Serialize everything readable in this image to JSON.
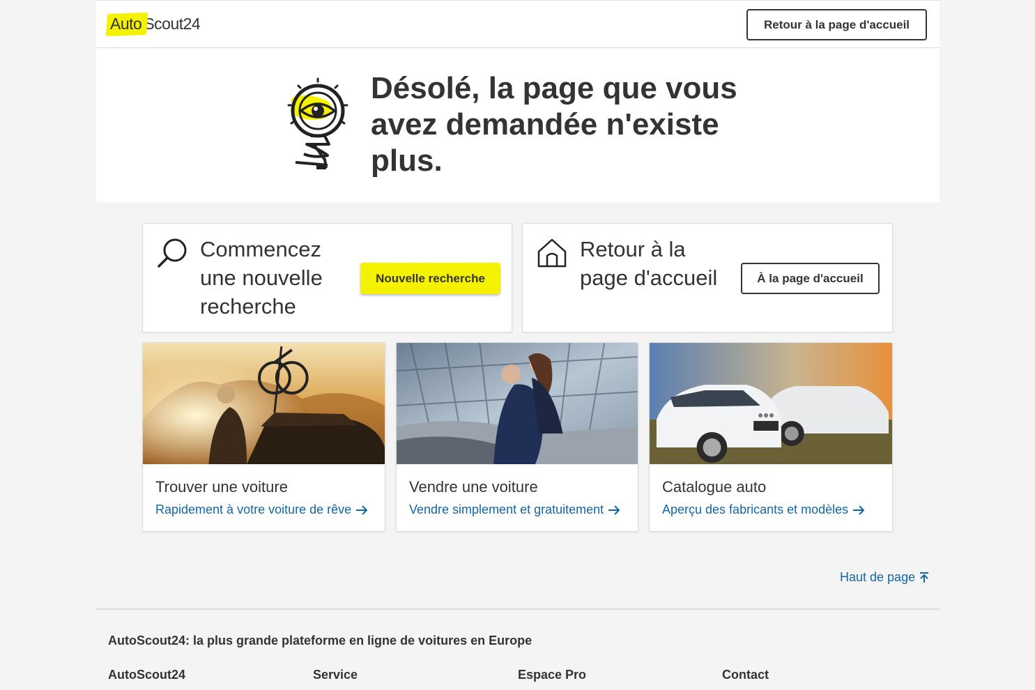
{
  "header": {
    "logo_part1": "Auto",
    "logo_part2": "Scout24",
    "home_button": "Retour à la page d'accueil"
  },
  "hero": {
    "title": "Désolé, la page que vous avez demandée n'existe plus.",
    "icon": "lightbulb-eye-icon"
  },
  "cards": {
    "search": {
      "text": "Commencez une nouvelle recherche",
      "button": "Nouvelle recherche",
      "icon": "search-icon"
    },
    "home": {
      "text": "Retour à la page d'accueil",
      "button": "À la page d'accueil",
      "icon": "home-icon"
    }
  },
  "tiles": [
    {
      "title": "Trouver une voiture",
      "link": "Rapidement à votre voiture de rêve"
    },
    {
      "title": "Vendre une voiture",
      "link": "Vendre simplement et gratuitement"
    },
    {
      "title": "Catalogue auto",
      "link": "Aperçu des fabricants et modèles"
    }
  ],
  "back_to_top": "Haut de page",
  "footer": {
    "title": "AutoScout24: la plus grande plateforme en ligne de voitures en Europe",
    "columns": [
      "AutoScout24",
      "Service",
      "Espace Pro",
      "Contact"
    ]
  },
  "colors": {
    "brand_yellow": "#f5f200",
    "link_blue": "#1166a8",
    "text": "#333333"
  }
}
